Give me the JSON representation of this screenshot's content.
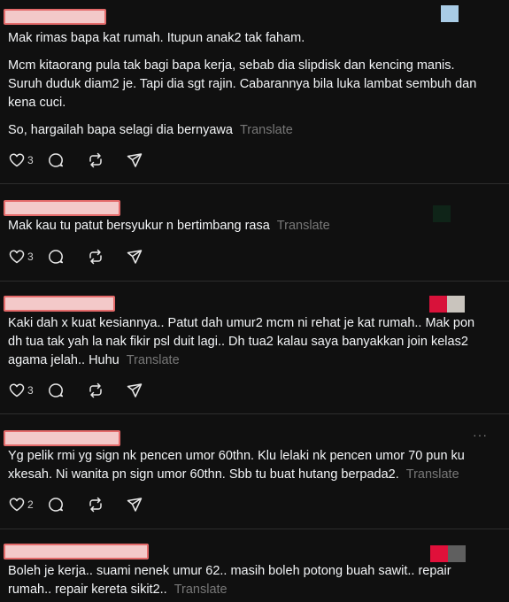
{
  "comments": [
    {
      "paragraphs": [
        "Mak rimas bapa kat rumah. Itupun anak2 tak faham.",
        "Mcm kitaorang pula tak bagi bapa kerja, sebab dia slipdisk dan kencing manis. Suruh duduk diam2 je. Tapi dia sgt rajin. Cabarannya bila luka lambat sembuh dan kena cuci.",
        "So, hargailah bapa selagi dia bernyawa"
      ],
      "translate": "Translate",
      "likes": "3",
      "avatar_colors": [
        "#a9cce6"
      ]
    },
    {
      "paragraphs": [
        "Mak kau tu patut bersyukur n bertimbang rasa"
      ],
      "translate": "Translate",
      "likes": "3",
      "avatar_colors": [
        "#0f2418"
      ]
    },
    {
      "paragraphs": [
        "Kaki dah x kuat kesiannya.. Patut dah umur2 mcm ni rehat je kat rumah.. Mak pon dh tua tak yah la nak fikir psl duit lagi.. Dh tua2 kalau saya banyakkan join kelas2 agama jelah.. Huhu"
      ],
      "translate": "Translate",
      "likes": "3",
      "avatar_colors": [
        "#d8123a",
        "#c9c4bd"
      ]
    },
    {
      "paragraphs": [
        "Yg pelik rmi yg sign nk pencen umor 60thn. Klu lelaki nk pencen umor 70 pun ku xkesah. Ni wanita pn sign umor 60thn. Sbb tu buat hutang berpada2."
      ],
      "translate": "Translate",
      "likes": "2",
      "more": "···",
      "avatar_colors": []
    },
    {
      "paragraphs": [
        "Boleh je kerja.. suami nenek umur 62.. masih boleh potong buah sawit.. repair rumah.. repair kereta sikit2.."
      ],
      "translate": "Translate",
      "likes": "",
      "avatar_colors": [
        "#e0103a",
        "#5f5f5f"
      ]
    }
  ],
  "colors": {
    "background": "#101010",
    "text": "#f3f5f7",
    "muted": "#777777",
    "redaction": "#f3c9c9",
    "redaction_border": "#e46a6a"
  },
  "icons": [
    "heart-icon",
    "reply-icon",
    "repost-icon",
    "share-icon"
  ]
}
